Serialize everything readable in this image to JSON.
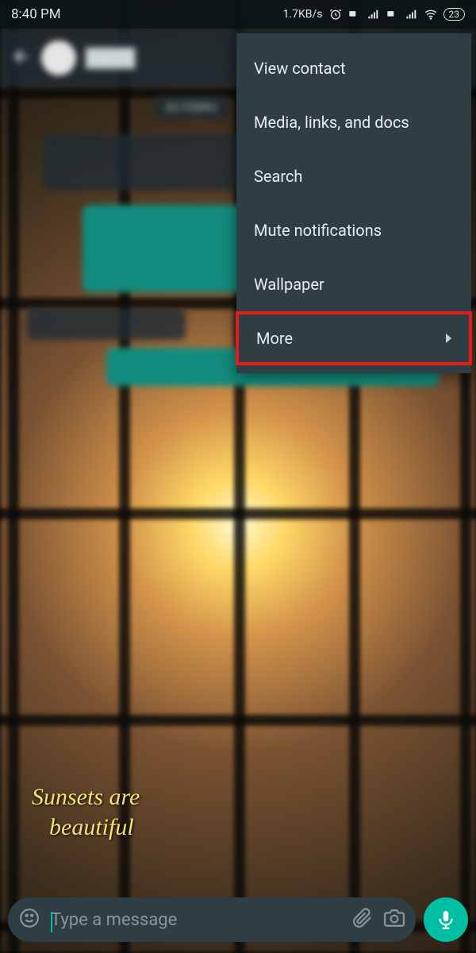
{
  "status": {
    "time": "8:40 PM",
    "net_speed": "1.7KB/s",
    "battery": "23"
  },
  "chat": {
    "date_label": "20 FEBRU",
    "caption_line1": "Sunsets are",
    "caption_line2": "beautiful"
  },
  "menu": {
    "items": [
      {
        "label": "View contact",
        "has_chevron": false
      },
      {
        "label": "Media, links, and docs",
        "has_chevron": false
      },
      {
        "label": "Search",
        "has_chevron": false
      },
      {
        "label": "Mute notifications",
        "has_chevron": false
      },
      {
        "label": "Wallpaper",
        "has_chevron": false
      },
      {
        "label": "More",
        "has_chevron": true,
        "highlighted": true
      }
    ]
  },
  "input": {
    "placeholder": "Type a message"
  }
}
